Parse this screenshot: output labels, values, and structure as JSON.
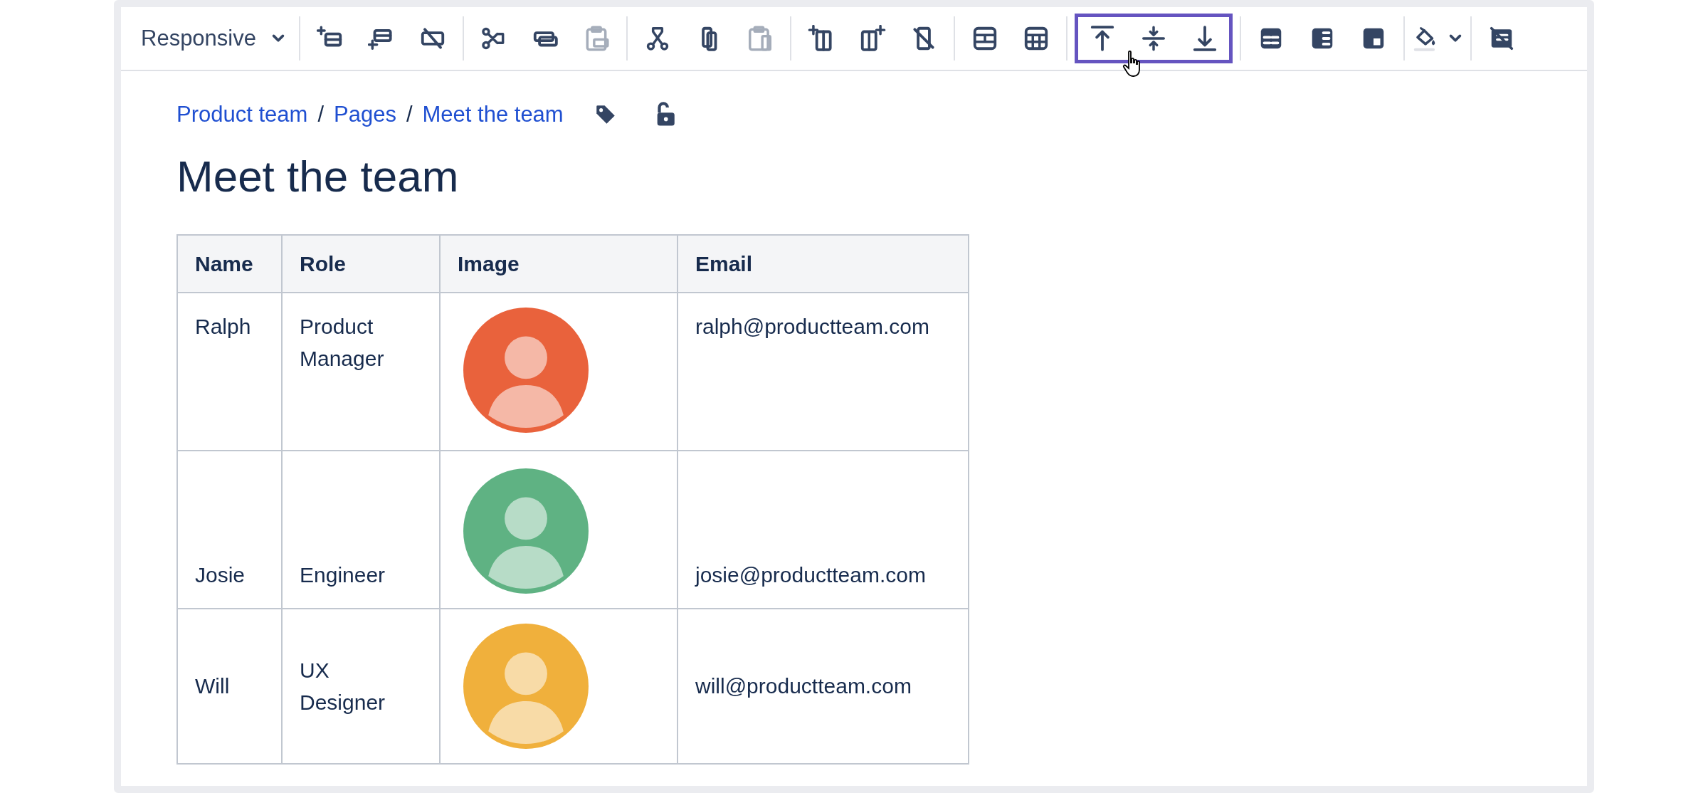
{
  "toolbar": {
    "dropdown": {
      "label": "Responsive"
    },
    "groups": [
      {
        "highlighted": false,
        "buttons": [
          {
            "disabled": false
          },
          {
            "disabled": false
          },
          {
            "disabled": false
          }
        ]
      },
      {
        "highlighted": false,
        "buttons": [
          {
            "disabled": false
          },
          {
            "disabled": false
          },
          {
            "disabled": true
          }
        ]
      },
      {
        "highlighted": false,
        "buttons": [
          {
            "disabled": false
          },
          {
            "disabled": false
          },
          {
            "disabled": true
          }
        ]
      },
      {
        "highlighted": false,
        "buttons": [
          {
            "disabled": false
          },
          {
            "disabled": false
          },
          {
            "disabled": false
          }
        ]
      },
      {
        "highlighted": false,
        "buttons": [
          {
            "disabled": false
          },
          {
            "disabled": false
          }
        ]
      },
      {
        "highlighted": true,
        "buttons": [
          {
            "disabled": false
          },
          {
            "disabled": false
          },
          {
            "disabled": false
          }
        ]
      },
      {
        "highlighted": false,
        "buttons": [
          {
            "disabled": false
          },
          {
            "disabled": false
          },
          {
            "disabled": false
          }
        ]
      },
      {
        "highlighted": false,
        "buttons": [
          {
            "disabled": false
          }
        ]
      },
      {
        "highlighted": false,
        "buttons": [
          {
            "disabled": false
          }
        ]
      }
    ]
  },
  "breadcrumb": {
    "items": [
      "Product team",
      "Pages",
      "Meet the team"
    ],
    "separator": "/"
  },
  "title": "Meet the team",
  "table": {
    "columns": [
      "Name",
      "Role",
      "Image",
      "Email"
    ],
    "rows": [
      {
        "name": "Ralph",
        "role": "Product Manager",
        "color": "#e9623c",
        "email": "ralph@productteam.com",
        "kind": "top"
      },
      {
        "name": "Josie",
        "role": "Engineer",
        "color": "#5fb283",
        "email": "josie@productteam.com",
        "kind": "bottom"
      },
      {
        "name": "Will",
        "role": "UX Designer",
        "color": "#f0b03c",
        "email": "will@productteam.com",
        "kind": "middle"
      }
    ]
  }
}
